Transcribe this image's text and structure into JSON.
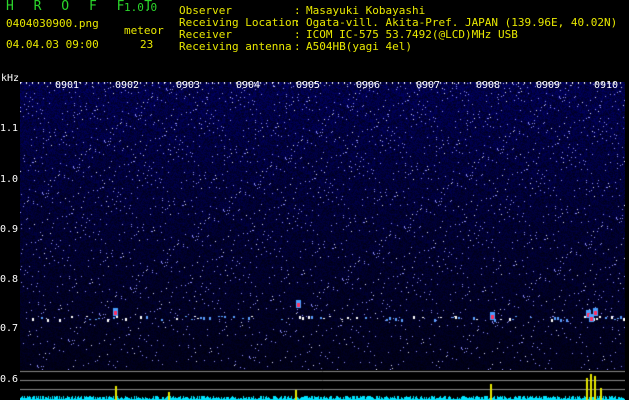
{
  "app": {
    "title": "H R O F F T",
    "version": "1.0.0"
  },
  "file": {
    "name": "0404030900.png",
    "datetime": "04.04.03 09:00"
  },
  "meteor": {
    "label": "meteor",
    "count": "23"
  },
  "info": [
    {
      "key": "Observer",
      "value": "Masayuki Kobayashi"
    },
    {
      "key": "Receiving Location",
      "value": "Ogata-vill. Akita-Pref. JAPAN (139.96E, 40.02N)"
    },
    {
      "key": "Receiver",
      "value": "ICOM IC-575 53.7492(@LCD)MHz USB"
    },
    {
      "key": "Receiving antenna",
      "value": "A504HB(yagi 4el)"
    }
  ],
  "info_sep": ":",
  "axis": {
    "unit": "kHz",
    "y_ticks": [
      "1.1",
      "1.0",
      "0.9",
      "0.8",
      "0.7",
      "0.6"
    ],
    "x_ticks": [
      "0901",
      "0902",
      "0903",
      "0904",
      "0905",
      "0906",
      "0907",
      "0908",
      "0909",
      "0910"
    ]
  },
  "colors": {
    "green": "#2bd62b",
    "yellow": "#e8e800",
    "background": "#000000"
  }
}
